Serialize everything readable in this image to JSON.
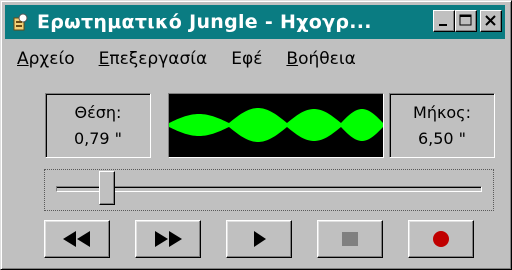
{
  "window": {
    "title": "Ερωτηματικό Jungle - Ηχογρ...",
    "icon": "sound-recorder-icon",
    "controls": [
      "minimize-icon",
      "maximize-icon",
      "close-icon"
    ]
  },
  "menu": {
    "items": [
      {
        "first": "Α",
        "rest": "ρχείο"
      },
      {
        "first": "Ε",
        "rest": "πεξεργασία"
      },
      {
        "first": "Εφ",
        "rest": "έ",
        "underline_index": 1
      },
      {
        "first": "Β",
        "rest": "οήθεια"
      }
    ]
  },
  "position": {
    "label": "Θέση:",
    "value": "0,79 \""
  },
  "length": {
    "label": "Μήκος:",
    "value": "6,50 \""
  },
  "waveform": {
    "color": "#00ff00",
    "background": "#000000"
  },
  "slider": {
    "position_fraction": 0.12
  },
  "transport": {
    "buttons": [
      {
        "name": "seek-to-start-button",
        "icon": "rewind-icon"
      },
      {
        "name": "seek-to-end-button",
        "icon": "fast-forward-icon"
      },
      {
        "name": "play-button",
        "icon": "play-icon"
      },
      {
        "name": "stop-button",
        "icon": "stop-icon"
      },
      {
        "name": "record-button",
        "icon": "record-icon",
        "color": "#c00000"
      }
    ]
  }
}
